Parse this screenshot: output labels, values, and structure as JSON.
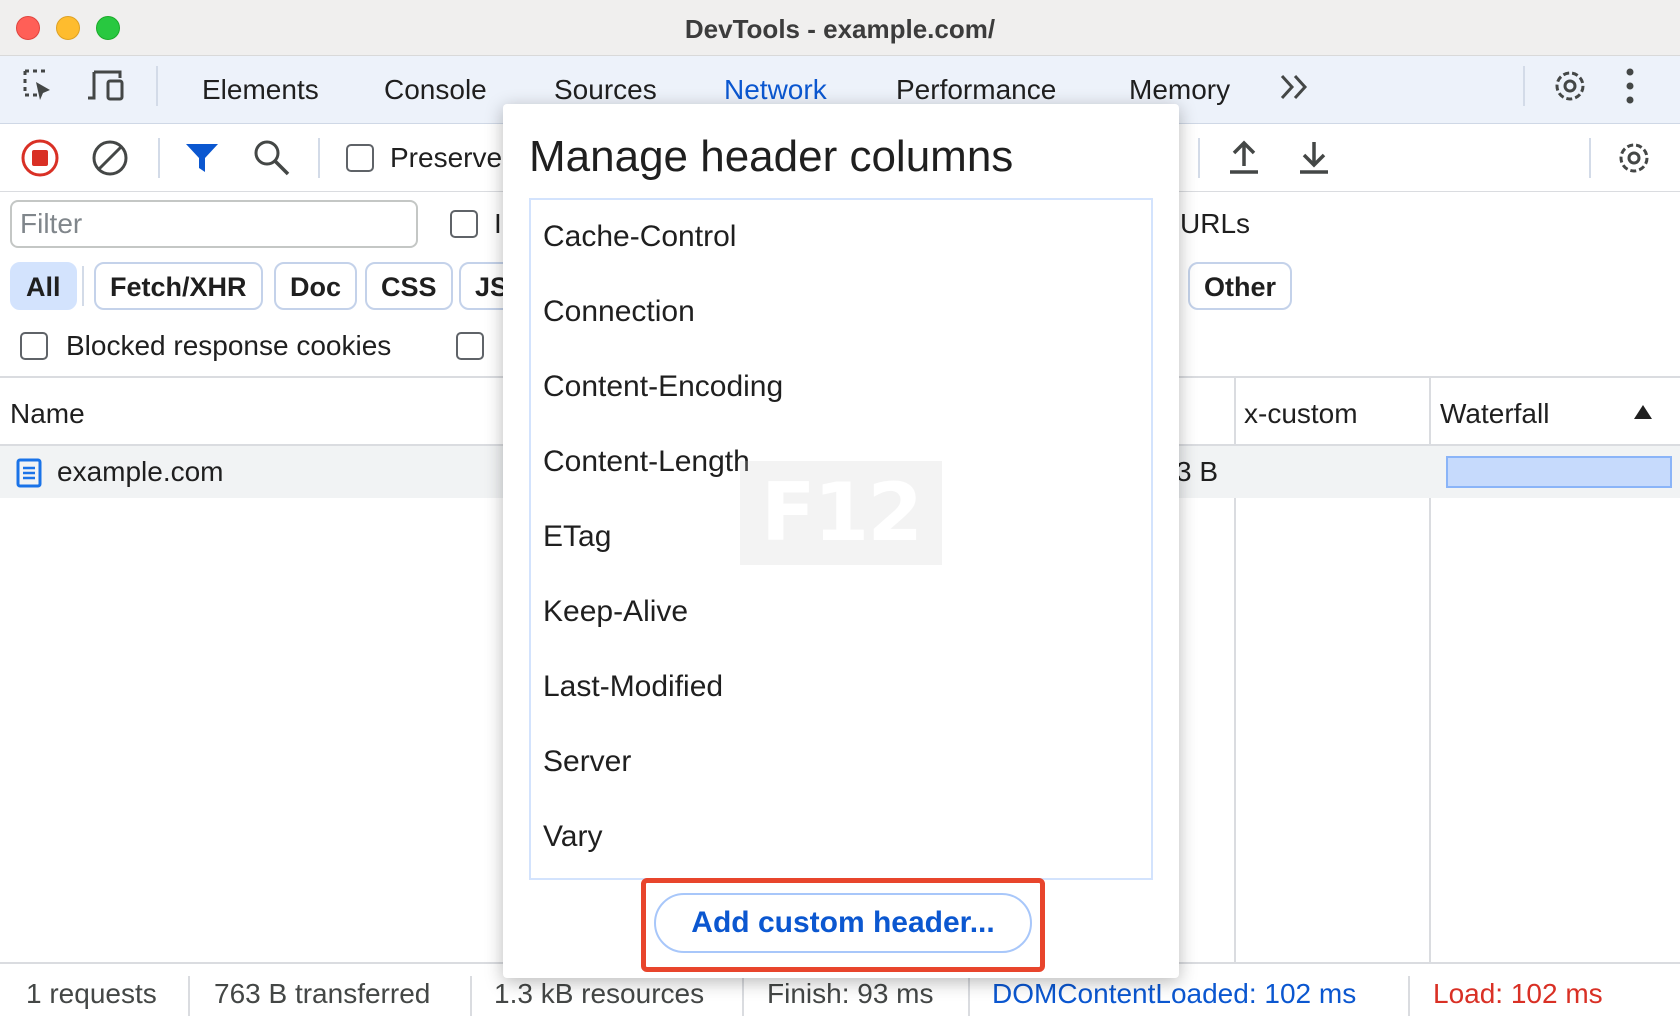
{
  "window": {
    "title": "DevTools - example.com/"
  },
  "tabs": [
    {
      "label": "Elements"
    },
    {
      "label": "Console"
    },
    {
      "label": "Sources"
    },
    {
      "label": "Network"
    },
    {
      "label": "Performance"
    },
    {
      "label": "Memory"
    }
  ],
  "active_tab": "Network",
  "toolbar": {
    "preserve_log_label": "Preserve"
  },
  "filter": {
    "placeholder": "Filter",
    "urls_label": "URLs",
    "invert_label": "I"
  },
  "type_chips": [
    {
      "label": "All",
      "active": true
    },
    {
      "label": "Fetch/XHR"
    },
    {
      "label": "Doc"
    },
    {
      "label": "CSS"
    },
    {
      "label": "JS"
    },
    {
      "label": "Other"
    }
  ],
  "blocked_cookies_label": "Blocked response cookies",
  "table": {
    "columns": {
      "name": "Name",
      "custom": "x-custom",
      "waterfall": "Waterfall"
    },
    "rows": [
      {
        "name": "example.com",
        "size": "3 B"
      }
    ]
  },
  "status": {
    "requests": "1 requests",
    "transferred": "763 B transferred",
    "resources": "1.3 kB resources",
    "finish": "Finish: 93 ms",
    "dom_content_loaded": "DOMContentLoaded: 102 ms",
    "load": "Load: 102 ms"
  },
  "dialog": {
    "title": "Manage header columns",
    "headers": [
      "Cache-Control",
      "Connection",
      "Content-Encoding",
      "Content-Length",
      "ETag",
      "Keep-Alive",
      "Last-Modified",
      "Server",
      "Vary"
    ],
    "watermark": "F12",
    "add_button": "Add custom header..."
  },
  "colors": {
    "accent": "#0b57d0",
    "highlight": "#e8452c",
    "load": "#d93025",
    "record": "#d93025"
  },
  "icons": [
    "inspect-icon",
    "device-toolbar-icon",
    "more-tabs-icon",
    "settings-icon",
    "more-options-icon",
    "record-icon",
    "clear-icon",
    "filter-icon",
    "search-icon",
    "upload-icon",
    "download-icon",
    "network-settings-icon",
    "document-icon",
    "sort-ascending-icon"
  ]
}
